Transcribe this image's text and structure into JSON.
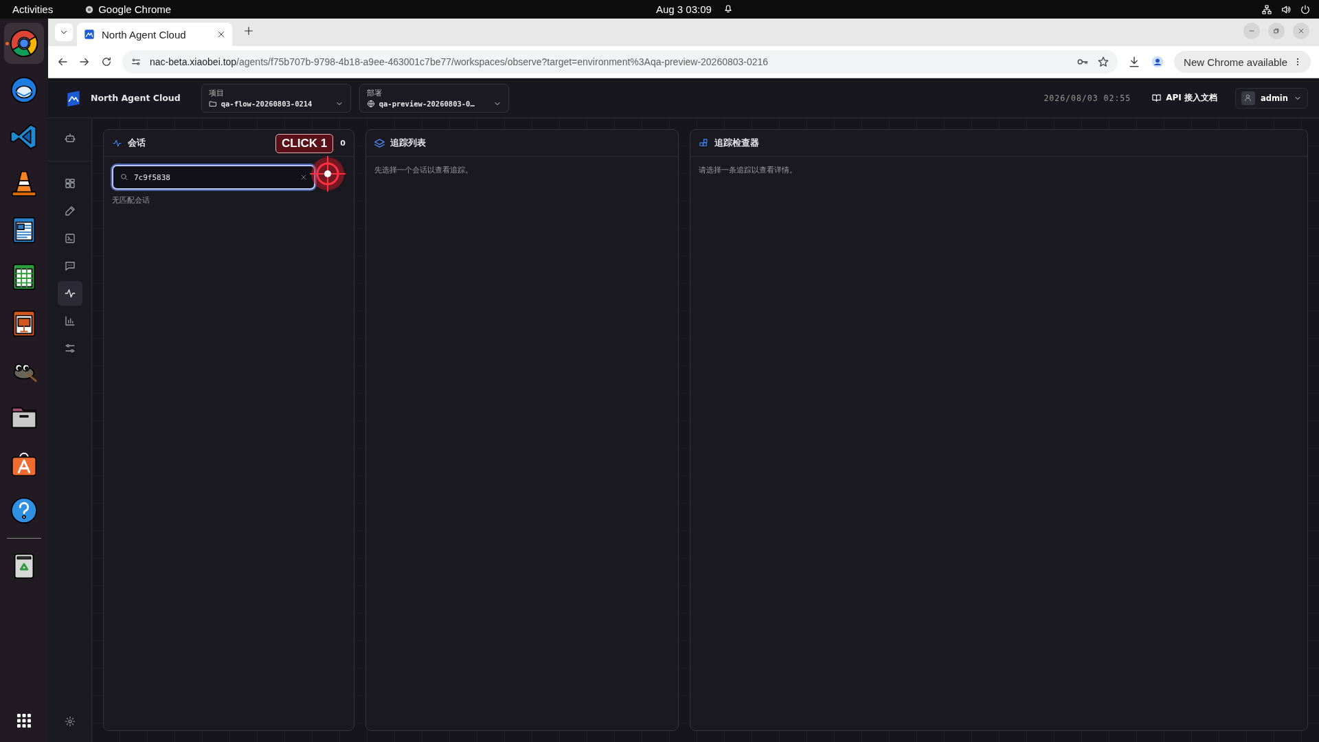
{
  "top_bar": {
    "activities": "Activities",
    "app": "Google Chrome",
    "clock": "Aug 3  03:09"
  },
  "dock": [
    {
      "kind": "chrome",
      "running": true
    },
    {
      "kind": "mail",
      "running": false
    },
    {
      "kind": "code",
      "running": false
    },
    {
      "kind": "cone",
      "running": false
    },
    {
      "kind": "writer",
      "running": false
    },
    {
      "kind": "calc",
      "running": false
    },
    {
      "kind": "impress",
      "running": false
    },
    {
      "kind": "gimp",
      "running": false
    },
    {
      "kind": "files",
      "running": false
    },
    {
      "kind": "store",
      "running": false
    },
    {
      "kind": "help",
      "running": false
    },
    {
      "kind": "trash",
      "running": false
    }
  ],
  "browser": {
    "tab_title": "North Agent Cloud",
    "url_host": "nac-beta.xiaobei.top",
    "url_path": "/agents/f75b707b-9798-4b18-a9ee-463001c7be77/workspaces/observe?target=environment%3Aqa-preview-20260803-0216",
    "update_button": "New Chrome available"
  },
  "header": {
    "brand": "North Agent Cloud",
    "project": {
      "label": "项目",
      "value": "qa-flow-20260803-0214"
    },
    "deployment": {
      "label": "部署",
      "value": "qa-preview-20260803-0…"
    },
    "timestamp": "2026/08/03 02:55",
    "api_docs": "API 接入文档",
    "user": "admin"
  },
  "nav": [
    {
      "kind": "bot",
      "selected": false
    },
    {
      "kind": "grid",
      "selected": false
    },
    {
      "kind": "pen",
      "selected": false
    },
    {
      "kind": "terminal",
      "selected": false
    },
    {
      "kind": "chat",
      "selected": false
    },
    {
      "kind": "pulse",
      "selected": true
    },
    {
      "kind": "chart",
      "selected": false
    },
    {
      "kind": "sliders",
      "selected": false
    }
  ],
  "sessions": {
    "title": "会话",
    "count": "0",
    "search_value": "7c9f5838",
    "empty": "无匹配会话"
  },
  "traces": {
    "title": "追踪列表",
    "hint": "先选择一个会话以查看追踪。"
  },
  "inspector": {
    "title": "追踪检查器",
    "hint": "请选择一条追踪以查看详情。"
  },
  "click_marker": {
    "label": "CLICK 1"
  }
}
